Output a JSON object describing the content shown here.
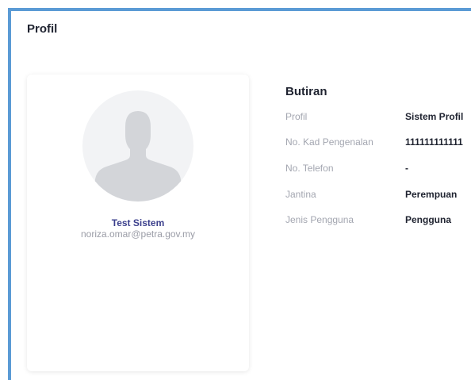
{
  "header": {
    "title": "Profil"
  },
  "profile": {
    "avatar_icon": "user-silhouette-icon",
    "name": "Test Sistem",
    "email": "noriza.omar@petra.gov.my"
  },
  "details": {
    "title": "Butiran",
    "rows": [
      {
        "label": "Profil",
        "value": "Sistem Profil"
      },
      {
        "label": "No. Kad Pengenalan",
        "value": "111111111111"
      },
      {
        "label": "No. Telefon",
        "value": "-"
      },
      {
        "label": "Jantina",
        "value": "Perempuan"
      },
      {
        "label": "Jenis Pengguna",
        "value": "Pengguna"
      }
    ]
  }
}
